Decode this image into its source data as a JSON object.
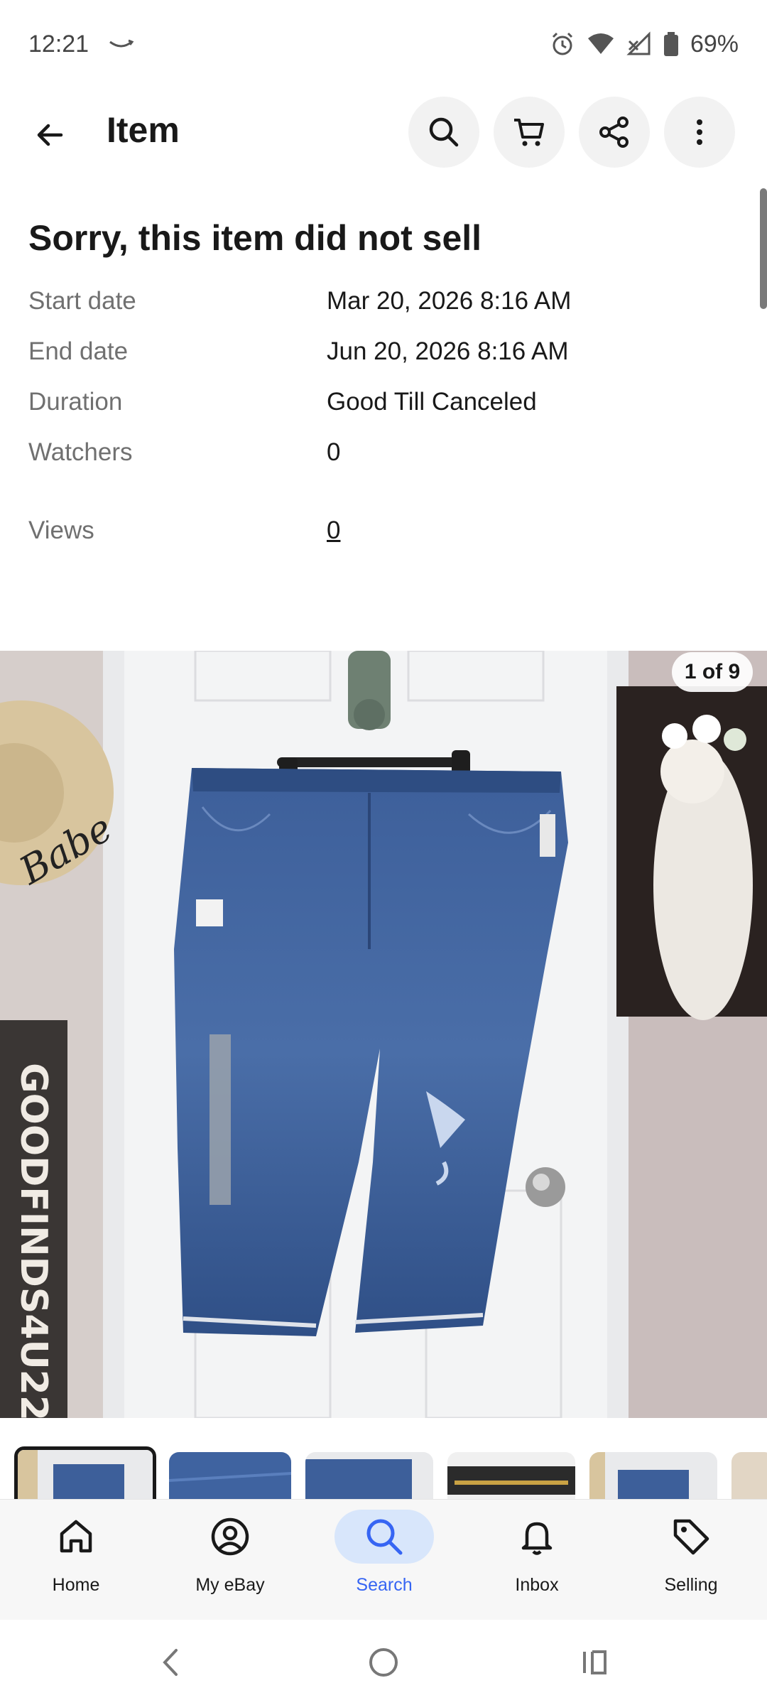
{
  "status_bar": {
    "time": "12:21",
    "battery": "69%"
  },
  "header": {
    "title": "Item"
  },
  "item_status": {
    "title": "Sorry, this item did not sell",
    "details": [
      {
        "label": "Start date",
        "value": "Mar 20, 2026 8:16 AM"
      },
      {
        "label": "End date",
        "value": "Jun 20, 2026 8:16 AM"
      },
      {
        "label": "Duration",
        "value": "Good Till Canceled"
      },
      {
        "label": "Watchers",
        "value": "0"
      }
    ],
    "views": {
      "label": "Views",
      "value": "0"
    }
  },
  "photo": {
    "counter": "1 of 9",
    "sign_text": "GOODFINDS4U22",
    "hat_text": "Babe",
    "thumbnail_count": 6
  },
  "bottom_nav": [
    {
      "label": "Home",
      "icon": "home-icon"
    },
    {
      "label": "My eBay",
      "icon": "user-circle-icon"
    },
    {
      "label": "Search",
      "icon": "search-icon",
      "active": true
    },
    {
      "label": "Inbox",
      "icon": "bell-icon"
    },
    {
      "label": "Selling",
      "icon": "tag-icon"
    }
  ],
  "colors": {
    "accent": "#3665f3",
    "active_nav_bg": "#d8e6fb",
    "label_gray": "#707070",
    "text": "#191919"
  }
}
